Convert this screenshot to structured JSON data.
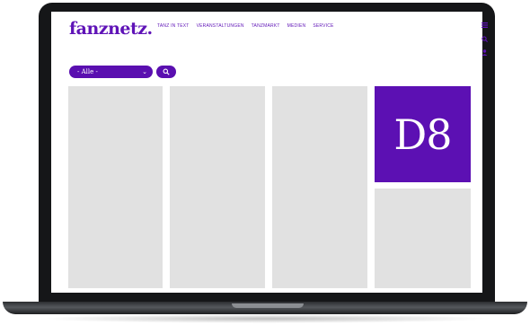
{
  "site": {
    "logo": "fanznetz.",
    "nav": [
      "TANZ IN TEXT",
      "VERANSTALTUNGEN",
      "TANZMARKT",
      "MEDIEN",
      "SERVICE"
    ]
  },
  "utility_icons": [
    "menu-icon",
    "search-icon",
    "user-icon"
  ],
  "filter": {
    "selected": "- Alle -",
    "chevron_icon": "chevron-down-icon",
    "search_icon": "search-icon"
  },
  "ad": {
    "label": "D8",
    "background": "#5c10b3"
  },
  "colors": {
    "brand": "#5f13b7",
    "placeholder": "#e1e1e1",
    "frame": "#151618"
  }
}
